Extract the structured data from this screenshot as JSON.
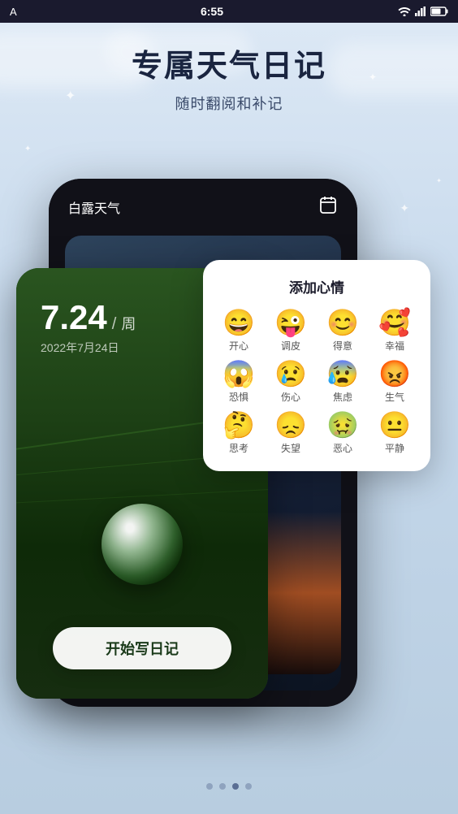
{
  "statusBar": {
    "time": "6:55",
    "leftLabel": "A"
  },
  "header": {
    "mainTitle": "专属天气日记",
    "subTitle": "随时翻阅和补记"
  },
  "phone": {
    "appName": "白露天气",
    "calendarIconLabel": "📅"
  },
  "diaryCard": {
    "dateNumber": "7.24",
    "separator": "/",
    "weekLabel": "周",
    "dateFull": "2022年7月24日",
    "startButton": "开始写日记"
  },
  "moodPopup": {
    "title": "添加心情",
    "moods": [
      {
        "emoji": "😄",
        "label": "开心"
      },
      {
        "emoji": "😜",
        "label": "调皮"
      },
      {
        "emoji": "😊",
        "label": "得意"
      },
      {
        "emoji": "🥰",
        "label": "幸福"
      },
      {
        "emoji": "😱",
        "label": "恐惧"
      },
      {
        "emoji": "😢",
        "label": "伤心"
      },
      {
        "emoji": "😰",
        "label": "焦虑"
      },
      {
        "emoji": "😡",
        "label": "生气"
      },
      {
        "emoji": "🤔",
        "label": "思考"
      },
      {
        "emoji": "😞",
        "label": "失望"
      },
      {
        "emoji": "🤢",
        "label": "恶心"
      },
      {
        "emoji": "😐",
        "label": "平静"
      }
    ]
  },
  "pagination": {
    "dots": [
      false,
      false,
      true,
      false
    ]
  },
  "sparkles": [
    "✦",
    "✦",
    "✦",
    "✦"
  ]
}
